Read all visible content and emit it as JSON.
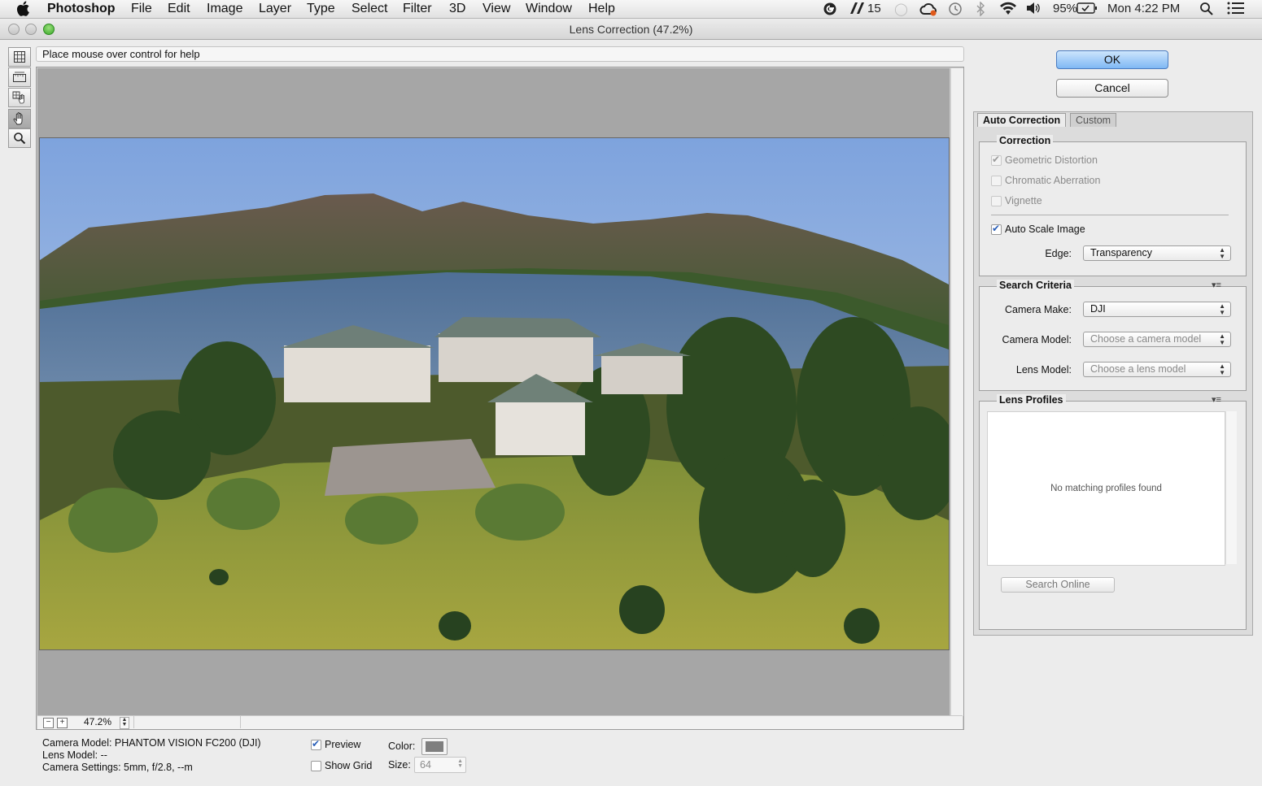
{
  "menubar": {
    "app_name": "Photoshop",
    "items": [
      "File",
      "Edit",
      "Image",
      "Layer",
      "Type",
      "Select",
      "Filter",
      "3D",
      "View",
      "Window",
      "Help"
    ],
    "adobe_count": "15",
    "battery": "95%",
    "clock": "Mon 4:22 PM"
  },
  "window": {
    "title": "Lens Correction (47.2%)"
  },
  "help_text": "Place mouse over control for help",
  "zoom": {
    "value": "47.2%",
    "minus": "−",
    "plus": "+"
  },
  "info": {
    "camera_model": "Camera Model: PHANTOM VISION FC200 (DJI)",
    "lens_model": "Lens Model: --",
    "camera_settings": "Camera Settings: 5mm, f/2.8, --m"
  },
  "preview_opts": {
    "preview_label": "Preview",
    "preview_checked": true,
    "show_grid_label": "Show Grid",
    "show_grid_checked": false,
    "color_label": "Color:",
    "grid_color": "#7f7f7f",
    "size_label": "Size:",
    "size_value": "64"
  },
  "buttons": {
    "ok": "OK",
    "cancel": "Cancel"
  },
  "tabs": {
    "auto": "Auto Correction",
    "custom": "Custom"
  },
  "correction": {
    "title": "Correction",
    "geometric": "Geometric Distortion",
    "chromatic": "Chromatic Aberration",
    "vignette": "Vignette",
    "auto_scale": "Auto Scale Image",
    "edge_label": "Edge:",
    "edge_value": "Transparency"
  },
  "search": {
    "title": "Search Criteria",
    "make_label": "Camera Make:",
    "make_value": "DJI",
    "model_label": "Camera Model:",
    "model_value": "Choose a camera model",
    "lens_label": "Lens Model:",
    "lens_value": "Choose a lens model"
  },
  "profiles": {
    "title": "Lens Profiles",
    "empty": "No matching profiles found",
    "search_online": "Search Online"
  },
  "colors": {
    "ok_button": "#7fb8f4",
    "accent_check": "#2a5fb8"
  }
}
